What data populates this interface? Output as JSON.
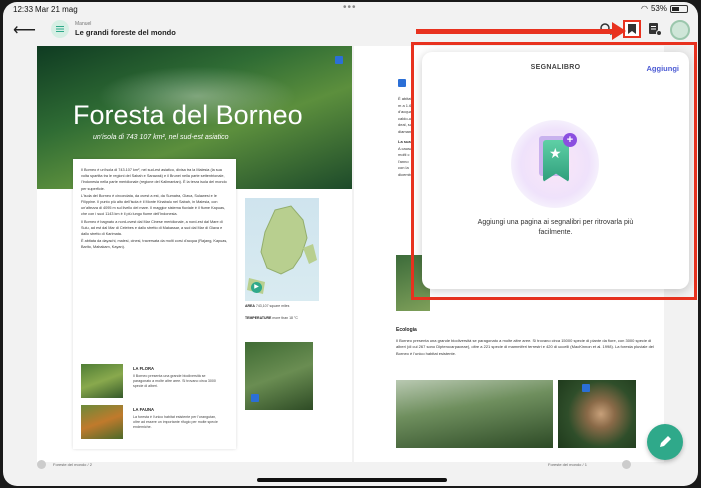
{
  "status": {
    "time": "12:33",
    "date": "Mar 21 mag",
    "battery": "53%",
    "battery_level": 0.53
  },
  "header": {
    "breadcrumb": "Manuel",
    "title": "Le grandi foreste del mondo"
  },
  "left_page": {
    "hero_title": "Foresta del Borneo",
    "hero_subtitle": "un'isola di 743 107 km², nel sud-est asiatico",
    "paragraphs": [
      "Il Borneo è un'isola di 743.107 km², nel sud-est asiatico, divisa tra la Malesia (la sua volta spartita tra le regioni del Sabah e Sarawak) e il Brunei nella parte settentrionale, l'Indonesia nella parte meridionale (regione del Kalimantan). È la terza isola del mondo per superficie.",
      "L'isola del Borneo è circondata, da ovest a est, da Sumatra, Giava, Sulawesi e le Filippine. Il punto più alto dell'isola è il Monte Kinabalu nel Sabah, in Malesia, con un'altezza di 4095 m sul livello del mare. Il maggior sistema fluviale è il fiume Kapuas, che con i suoi 1143 km è il più lungo fiume dell'Indonesia.",
      "Il Borneo è bagnato a nord-ovest dal Mar Cinese meridionale, a nord-est dal Mare di Sulu, ad est dal Mar di Celebes e dallo stretto di Makassar, a sud dal Mar di Giava e dallo stretto di Karimata.",
      "È abitata da dayachi, malesi, cinesi, traversata da molti corsi d'acqua (Rajang, Kapuas, Barito, Mahakam, Kayan)."
    ],
    "flora": {
      "heading": "LA FLORA",
      "text": "Il Borneo presenta una grande biodiversità se paragonato a molte altre aree. Si trovano circa 3000 specie di alberi."
    },
    "fauna": {
      "heading": "LA FAUNA",
      "text": "La foresta è l'unico habitat esistente per l'orangutan, oltre ad essere un importante rifugio per molte specie endemiche."
    },
    "map_caption_area_label": "AREA",
    "map_caption_area": "743,107 square miles",
    "map_caption_temp_label": "TEMPERATURE",
    "map_caption_temp": "more than 18 °C",
    "footer": "Foreste del mondo",
    "page_number": "2"
  },
  "right_page": {
    "intro": [
      "È abitat",
      "m a 1.65",
      "d'acqua",
      "caldo-u",
      "deal, su",
      "diamant"
    ],
    "subhead": "La sua p",
    "intro2": [
      "A causa",
      "molti c",
      "l'anno",
      "con la",
      "dicemb"
    ],
    "ecology_heading": "Ecologia",
    "ecology_text": "Il Borneo presenta una grande biodiversità se paragonato a molte altre aree. Si trovano circa 15000 specie di piante da fiore, con 3000 specie di alberi (di cui 267 sono Dipterocarpaceae), oltre a 221 specie di mammiferi terrestri e 420 di uccelli (MacKinnon et al. 1998). La foresta pluviale del Borneo è l'unico habitat esistente.",
    "footer": "Foreste del mondo",
    "page_number": "1"
  },
  "popup": {
    "title": "SEGNALIBRO",
    "add_label": "Aggiungi",
    "message": "Aggiungi una pagina ai segnalibri per ritrovarla più facilmente."
  },
  "colors": {
    "accent": "#2fa98a",
    "highlight": "#e8321f",
    "link": "#4c5bd4"
  }
}
